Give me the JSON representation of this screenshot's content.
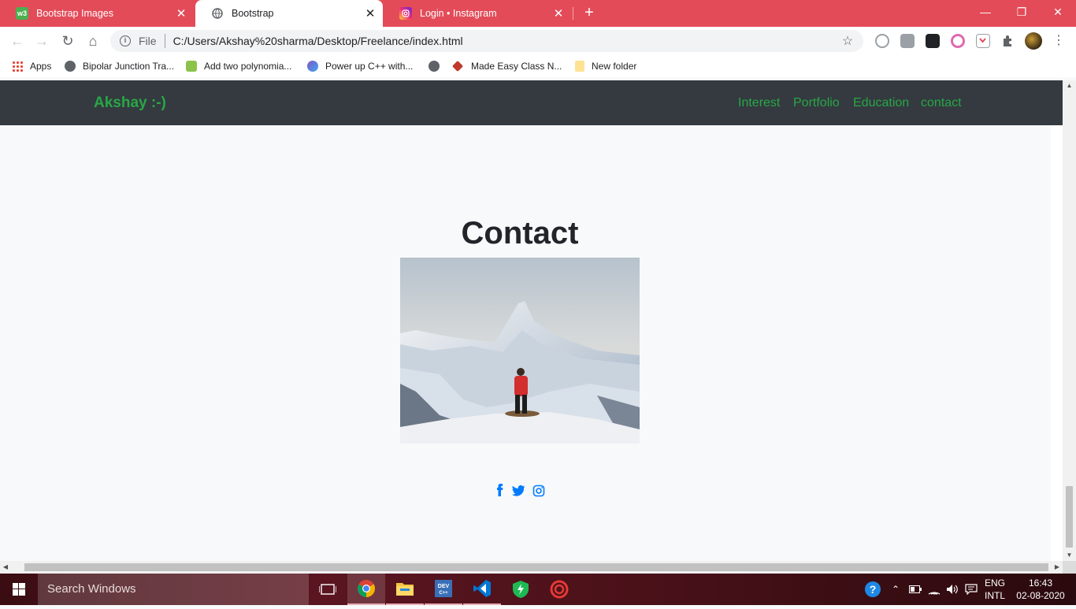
{
  "browser": {
    "tabs": [
      {
        "title": "Bootstrap Images",
        "favicon": "w3schools-icon"
      },
      {
        "title": "Bootstrap",
        "favicon": "globe-icon"
      },
      {
        "title": "Login • Instagram",
        "favicon": "instagram-icon"
      }
    ],
    "omnibox": {
      "scheme_label": "File",
      "url": "C:/Users/Akshay%20sharma/Desktop/Freelance/index.html"
    },
    "bookmarks": [
      {
        "label": "Apps"
      },
      {
        "label": "Bipolar Junction Tra..."
      },
      {
        "label": "Add two polynomia..."
      },
      {
        "label": "Power up C++ with..."
      },
      {
        "label": ""
      },
      {
        "label": "Made Easy Class N..."
      },
      {
        "label": "New folder"
      }
    ]
  },
  "site": {
    "brand": "Akshay :-)",
    "nav": [
      "Interest",
      "Portfolio",
      "Education",
      "contact"
    ],
    "section_title": "Contact",
    "social_icons": [
      "facebook-icon",
      "twitter-icon",
      "instagram-icon"
    ],
    "colors": {
      "brand": "#28a745",
      "navbar": "#343a40",
      "social": "#007bff"
    }
  },
  "taskbar": {
    "search_placeholder": "Search Windows",
    "lang_top": "ENG",
    "lang_bottom": "INTL",
    "time": "16:43",
    "date": "02-08-2020"
  }
}
